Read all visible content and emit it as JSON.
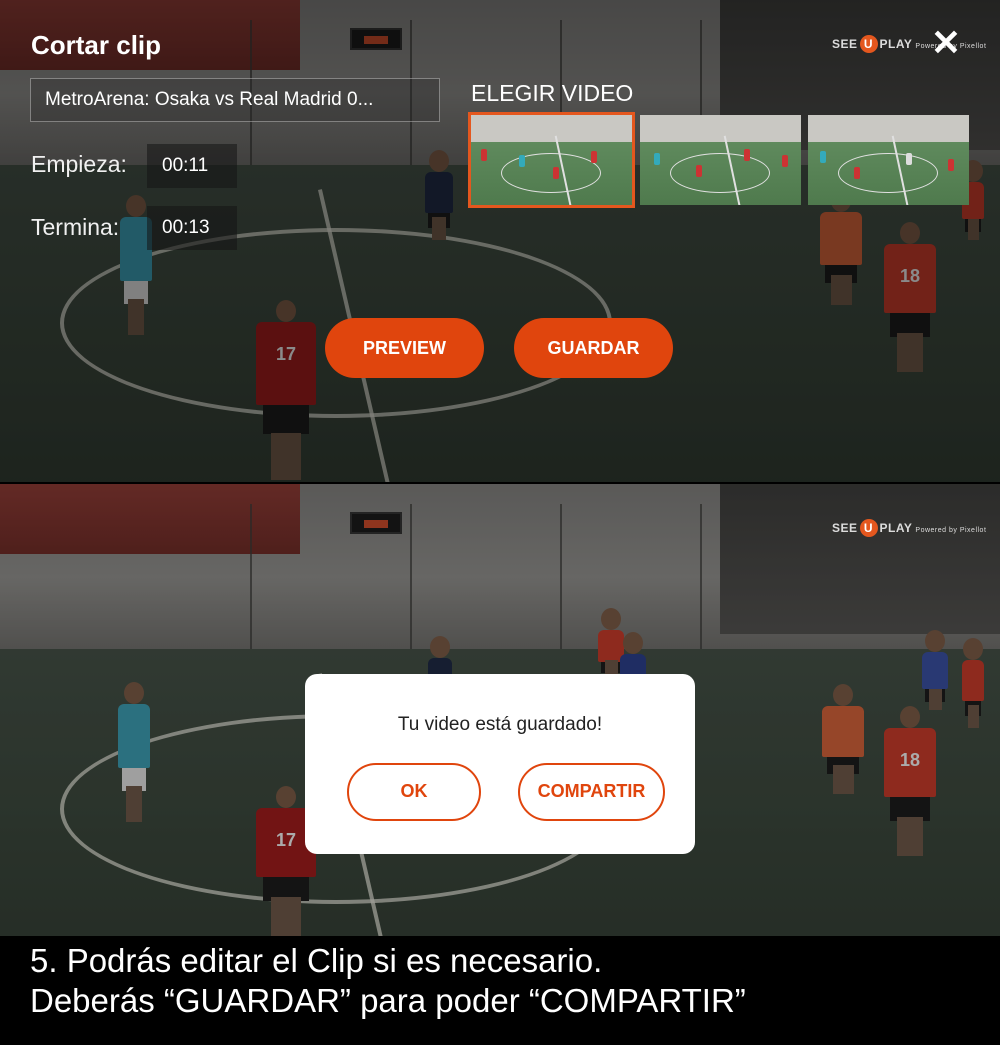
{
  "top": {
    "title": "Cortar clip",
    "close_icon": "close-icon",
    "logo_prefix": "SEE",
    "logo_u": "U",
    "logo_suffix": "PLAY",
    "logo_powered": "Powered by Pixellot",
    "video_selector_value": "MetroArena: Osaka vs Real Madrid 0...",
    "start_label": "Empieza:",
    "start_value": "00:11",
    "end_label": "Termina:",
    "end_value": "00:13",
    "choose_video_label": "ELEGIR VIDEO",
    "thumbnails_selected_index": 0,
    "preview_button": "PREVIEW",
    "save_button": "GUARDAR"
  },
  "bottom": {
    "logo_prefix": "SEE",
    "logo_u": "U",
    "logo_suffix": "PLAY",
    "logo_powered": "Powered by Pixellot",
    "dialog_message": "Tu video está guardado!",
    "ok_button": "OK",
    "share_button": "COMPARTIR"
  },
  "caption": {
    "line1": "5. Podrás editar el  Clip si es necesario.",
    "line2": "Deberás “GUARDAR” para poder “COMPARTIR”"
  },
  "player_numbers": [
    "17",
    "18"
  ],
  "colors": {
    "accent": "#e0450d",
    "selected_outline": "#e4571e",
    "dialog_bg": "#ffffff",
    "caption_bg": "#000000"
  }
}
